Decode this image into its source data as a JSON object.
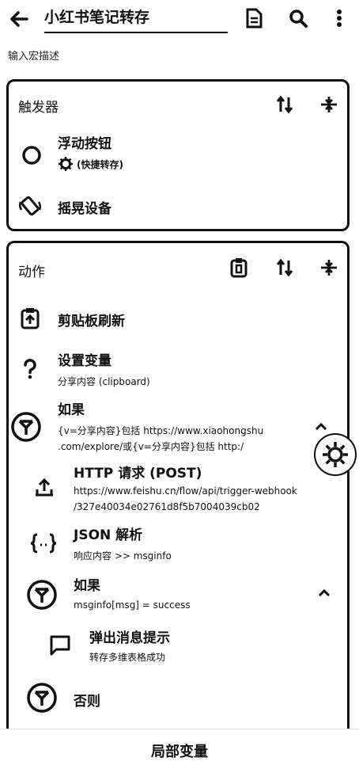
{
  "header": {
    "title": "小红书笔记转存",
    "description_placeholder": "输入宏描述"
  },
  "triggers": {
    "title": "触发器",
    "items": [
      {
        "title": "浮动按钮",
        "subtitle": "(快捷转存)"
      },
      {
        "title": "摇晃设备"
      }
    ]
  },
  "actions": {
    "title": "动作",
    "items": [
      {
        "title": "剪贴板刷新"
      },
      {
        "title": "设置变量",
        "subtitle": "分享内容 (clipboard)"
      },
      {
        "title": "如果",
        "line1": "{v=分享内容}包括 https://www.xiaohongshu",
        "line2": ".com/explore/或{v=分享内容}包括 http:/"
      },
      {
        "title": "HTTP 请求 (POST)",
        "line1": "https://www.feishu.cn/flow/api/trigger-webhook",
        "line2": "/327e40034e02761d8f5b7004039cb02"
      },
      {
        "title": "JSON 解析",
        "subtitle": "响应内容 >> msginfo"
      },
      {
        "title": "如果",
        "subtitle": "msginfo[msg] = success"
      },
      {
        "title": "弹出消息提示",
        "subtitle": "转存多维表格成功"
      },
      {
        "title": "否则"
      }
    ]
  },
  "bottom": {
    "label": "局部变量"
  }
}
